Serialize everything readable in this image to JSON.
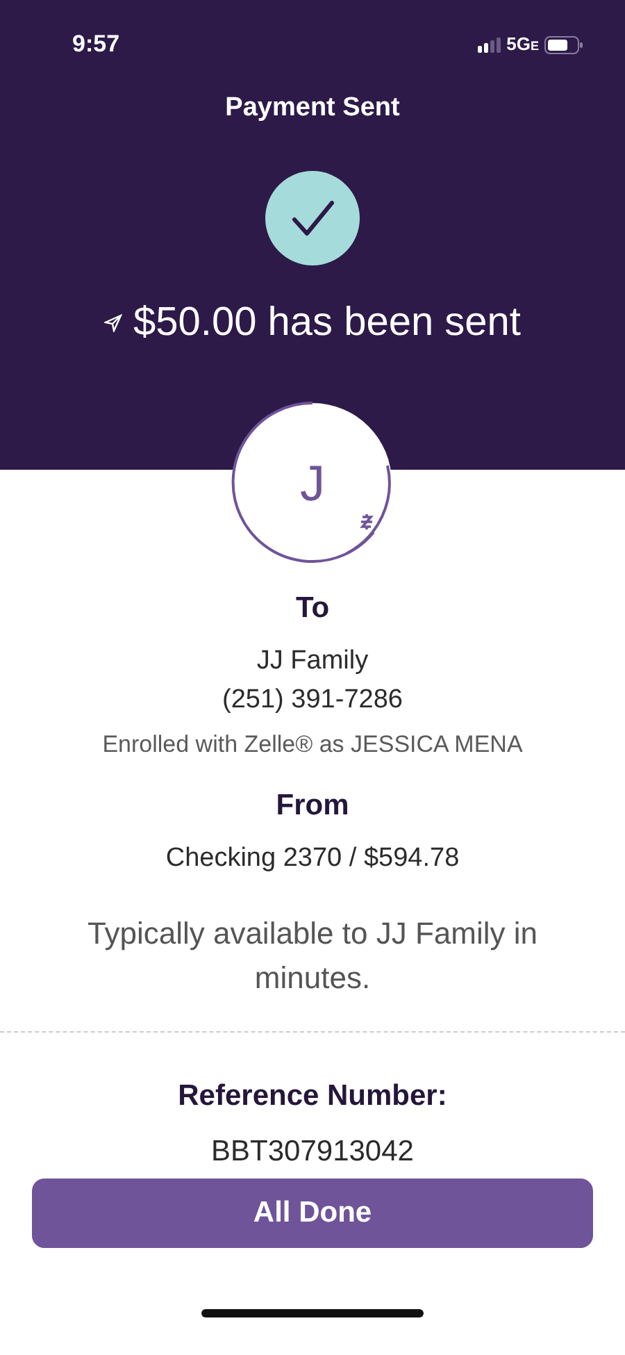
{
  "status_bar": {
    "time": "9:57",
    "network": "5G",
    "network_suffix": "E"
  },
  "header": {
    "title": "Payment Sent",
    "message": "$50.00 has been sent"
  },
  "recipient": {
    "initial": "J",
    "heading": "To",
    "name": "JJ Family",
    "phone": "(251) 391-7286",
    "enrolled": "Enrolled with Zelle® as JESSICA MENA"
  },
  "source": {
    "heading": "From",
    "account": "Checking 2370 / $594.78"
  },
  "availability": "Typically available to JJ Family in minutes.",
  "reference": {
    "heading": "Reference Number:",
    "number": "BBT307913042"
  },
  "buttons": [
    {
      "label": "All Done"
    }
  ]
}
